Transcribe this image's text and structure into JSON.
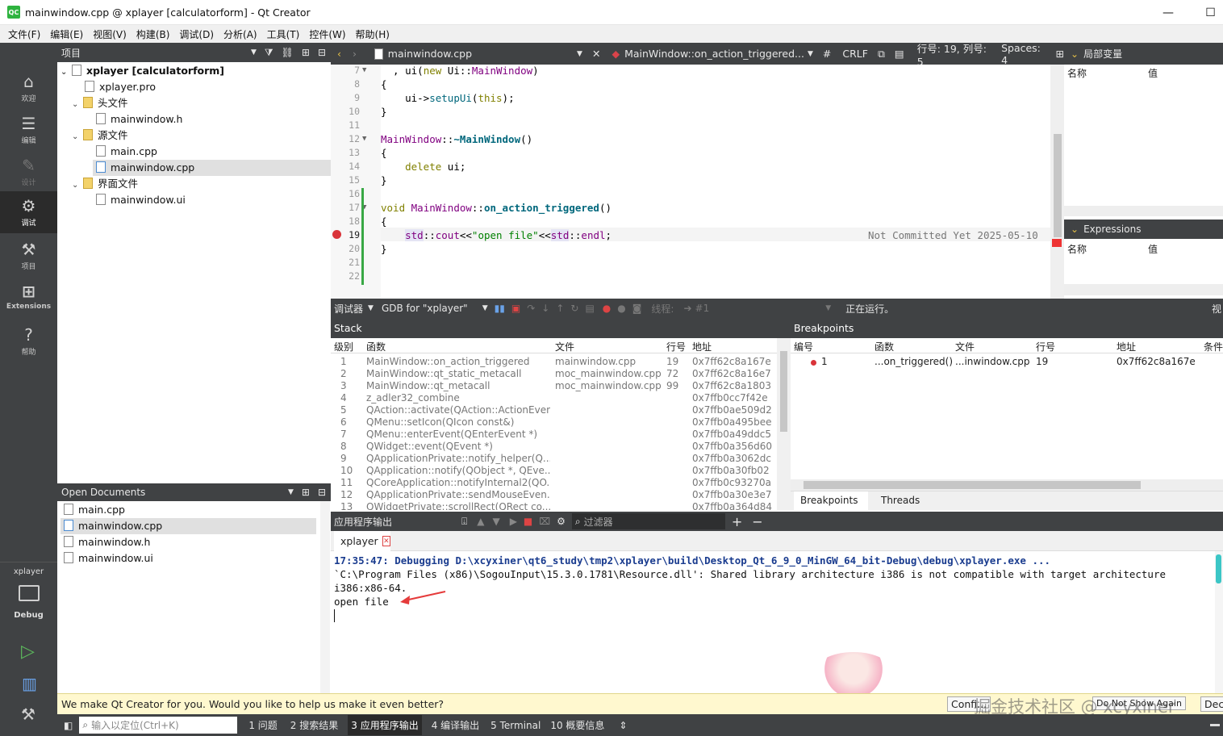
{
  "window": {
    "title": "mainwindow.cpp @ xplayer [calculatorform] - Qt Creator",
    "min": "—",
    "max": "☐"
  },
  "menu": [
    "文件(F)",
    "编辑(E)",
    "视图(V)",
    "构建(B)",
    "调试(D)",
    "分析(A)",
    "工具(T)",
    "控件(W)",
    "帮助(H)"
  ],
  "modes": [
    {
      "label": "欢迎",
      "icon": "home-icon"
    },
    {
      "label": "编辑",
      "icon": "edit-icon"
    },
    {
      "label": "设计",
      "icon": "design-icon"
    },
    {
      "label": "调试",
      "icon": "debug-icon"
    },
    {
      "label": "项目",
      "icon": "wrench-icon"
    },
    {
      "label": "Extensions",
      "icon": "extensions-icon"
    },
    {
      "label": "帮助",
      "icon": "help-icon"
    }
  ],
  "kit": {
    "project": "xplayer",
    "config": "Debug"
  },
  "project_panel": {
    "title": "项目",
    "tree": [
      {
        "label": "xplayer [calculatorform]",
        "level": 0,
        "bold": true
      },
      {
        "label": "xplayer.pro",
        "level": 1
      },
      {
        "label": "头文件",
        "level": 1
      },
      {
        "label": "mainwindow.h",
        "level": 2
      },
      {
        "label": "源文件",
        "level": 1
      },
      {
        "label": "main.cpp",
        "level": 2
      },
      {
        "label": "mainwindow.cpp",
        "level": 2,
        "selected": true
      },
      {
        "label": "界面文件",
        "level": 1
      },
      {
        "label": "mainwindow.ui",
        "level": 2
      }
    ]
  },
  "open_documents": {
    "title": "Open Documents",
    "items": [
      "main.cpp",
      "mainwindow.cpp",
      "mainwindow.h",
      "mainwindow.ui"
    ]
  },
  "editor_header": {
    "file": "mainwindow.cpp",
    "symbol": "MainWindow::on_action_triggered...",
    "hash": "#",
    "eol": "CRLF",
    "position": "行号: 19, 列号: 5",
    "spaces": "Spaces: 4"
  },
  "code": {
    "line_numbers": [
      "7",
      "8",
      "9",
      "10",
      "11",
      "12",
      "13",
      "14",
      "15",
      "16",
      "17",
      "18",
      "19",
      "20",
      "21",
      "22"
    ],
    "blame": "Not Committed Yet 2025-05-10"
  },
  "locals": {
    "title": "局部变量",
    "col_name": "名称",
    "col_value": "值"
  },
  "expressions": {
    "title": "Expressions",
    "col_name": "名称",
    "col_value": "值"
  },
  "debug_toolbar": {
    "label": "调试器",
    "engine": "GDB for \"xplayer\"",
    "thread_label": "线程:",
    "thread": "#1",
    "status": "正在运行。",
    "right": "视"
  },
  "stack": {
    "title": "Stack",
    "headers": [
      "级别",
      "函数",
      "文件",
      "行号",
      "地址"
    ],
    "rows": [
      [
        "1",
        "MainWindow::on_action_triggered",
        "mainwindow.cpp",
        "19",
        "0x7ff62c8a167e"
      ],
      [
        "2",
        "MainWindow::qt_static_metacall",
        "moc_mainwindow.cpp",
        "72",
        "0x7ff62c8a16e7"
      ],
      [
        "3",
        "MainWindow::qt_metacall",
        "moc_mainwindow.cpp",
        "99",
        "0x7ff62c8a1803"
      ],
      [
        "4",
        "z_adler32_combine",
        "",
        "",
        "0x7ffb0cc7f42e"
      ],
      [
        "5",
        "QAction::activate(QAction::ActionEvent)",
        "",
        "",
        "0x7ffb0ae509d2"
      ],
      [
        "6",
        "QMenu::setIcon(QIcon const&)",
        "",
        "",
        "0x7ffb0a495bee"
      ],
      [
        "7",
        "QMenu::enterEvent(QEnterEvent *)",
        "",
        "",
        "0x7ffb0a49ddc5"
      ],
      [
        "8",
        "QWidget::event(QEvent *)",
        "",
        "",
        "0x7ffb0a356d60"
      ],
      [
        "9",
        "QApplicationPrivate::notify_helper(Q...",
        "",
        "",
        "0x7ffb0a3062dc"
      ],
      [
        "10",
        "QApplication::notify(QObject *, QEve...",
        "",
        "",
        "0x7ffb0a30fb02"
      ],
      [
        "11",
        "QCoreApplication::notifyInternal2(QO...",
        "",
        "",
        "0x7ffb0c93270a"
      ],
      [
        "12",
        "QApplicationPrivate::sendMouseEven...",
        "",
        "",
        "0x7ffb0a30e3e7"
      ],
      [
        "13",
        "QWidgetPrivate::scrollRect(QRect co...",
        "",
        "",
        "0x7ffb0a364d84"
      ]
    ]
  },
  "breakpoints": {
    "title": "Breakpoints",
    "headers": [
      "编号",
      "函数",
      "文件",
      "行号",
      "地址",
      "条件"
    ],
    "rows": [
      [
        "1",
        "...on_triggered()",
        "...inwindow.cpp",
        "19",
        "0x7ff62c8a167e",
        ""
      ]
    ],
    "tabs": [
      "Breakpoints",
      "Threads"
    ]
  },
  "output": {
    "title": "应用程序输出",
    "filter_placeholder": "过滤器",
    "tab": "xplayer",
    "lines": [
      "17:35:47: Debugging D:\\xcyxiner\\qt6_study\\tmp2\\xplayer\\build\\Desktop_Qt_6_9_0_MinGW_64_bit-Debug\\debug\\xplayer.exe ...",
      "`C:\\Program Files (x86)\\SogouInput\\15.3.0.1781\\Resource.dll': Shared library architecture i386 is not compatible with target architecture",
      "i386:x86-64.",
      "open file"
    ]
  },
  "infobar": {
    "message": "We make Qt Creator for you. Would you like to help us make it even better?",
    "btn1": "Confi...",
    "btn2": "Do Not Show Again",
    "btn3": "Dec",
    "watermark": "掘金技术社区 @ xcyxiner"
  },
  "statusbar": {
    "locator_placeholder": "输入以定位(Ctrl+K)",
    "panes": [
      "1 问题",
      "2 搜索结果",
      "3 应用程序输出",
      "4 编译输出",
      "5 Terminal",
      "10 概要信息"
    ]
  }
}
